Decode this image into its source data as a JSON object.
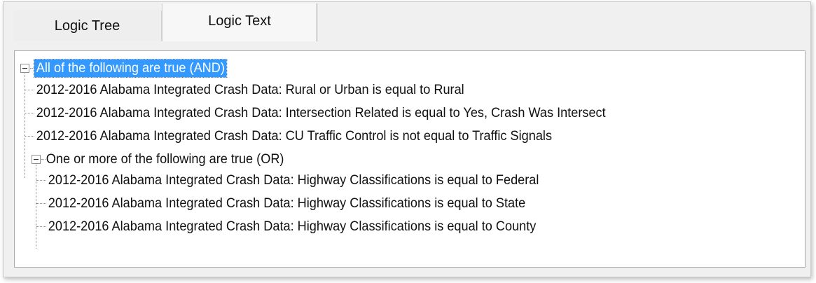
{
  "tabs": [
    {
      "label": "Logic Tree"
    },
    {
      "label": "Logic Text"
    }
  ],
  "tree": {
    "root": {
      "label": "All of the following are true (AND)",
      "selected": true,
      "children": [
        {
          "label": "2012-2016 Alabama Integrated Crash Data: Rural or Urban is equal to Rural"
        },
        {
          "label": "2012-2016 Alabama Integrated Crash Data: Intersection Related is equal to Yes, Crash Was Intersect"
        },
        {
          "label": "2012-2016 Alabama Integrated Crash Data: CU Traffic Control is not equal to Traffic Signals"
        }
      ],
      "group": {
        "label": "One or more of the following are true (OR)",
        "children": [
          {
            "label": "2012-2016 Alabama Integrated Crash Data: Highway Classifications is equal to Federal"
          },
          {
            "label": "2012-2016 Alabama Integrated Crash Data: Highway Classifications is equal to State"
          },
          {
            "label": "2012-2016 Alabama Integrated Crash Data: Highway Classifications is equal to County"
          }
        ]
      }
    }
  },
  "icons": {
    "expander": "minus-box-icon"
  }
}
